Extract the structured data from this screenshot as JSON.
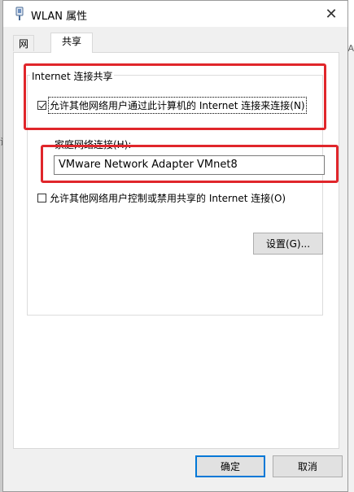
{
  "window": {
    "title": "WLAN 属性",
    "close_glyph": "✕"
  },
  "tabs": [
    {
      "label": "网络",
      "active": false
    },
    {
      "label": "共享",
      "active": true
    }
  ],
  "sharing": {
    "group_title": "Internet 连接共享",
    "allow_sharing_label": "允许其他网络用户通过此计算机的 Internet 连接来连接(N)",
    "allow_sharing_checked": true,
    "home_network_label": "家庭网络连接(H):",
    "home_network_value": "VMware Network Adapter VMnet8",
    "allow_control_label": "允许其他网络用户控制或禁用共享的 Internet 连接(O)",
    "allow_control_checked": false,
    "settings_button": "设置(G)..."
  },
  "footer": {
    "ok_button": "确定",
    "cancel_button": "取消"
  },
  "background": {
    "left_fragment": "设",
    "right_fragment": "A"
  },
  "colors": {
    "annotation_red": "#e0262b",
    "focus_blue": "#0078d7"
  }
}
